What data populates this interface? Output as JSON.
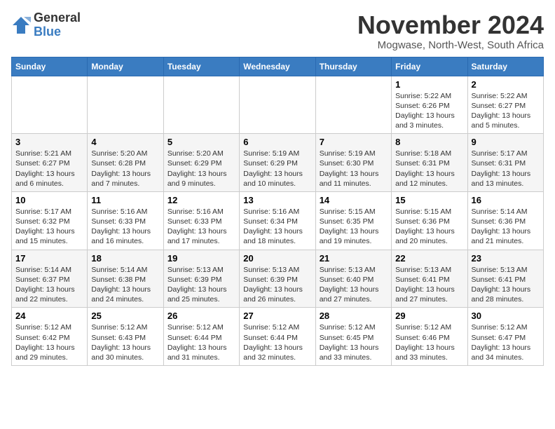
{
  "header": {
    "logo_general": "General",
    "logo_blue": "Blue",
    "month_title": "November 2024",
    "subtitle": "Mogwase, North-West, South Africa"
  },
  "days_of_week": [
    "Sunday",
    "Monday",
    "Tuesday",
    "Wednesday",
    "Thursday",
    "Friday",
    "Saturday"
  ],
  "weeks": [
    [
      {
        "day": "",
        "info": ""
      },
      {
        "day": "",
        "info": ""
      },
      {
        "day": "",
        "info": ""
      },
      {
        "day": "",
        "info": ""
      },
      {
        "day": "",
        "info": ""
      },
      {
        "day": "1",
        "info": "Sunrise: 5:22 AM\nSunset: 6:26 PM\nDaylight: 13 hours and 3 minutes."
      },
      {
        "day": "2",
        "info": "Sunrise: 5:22 AM\nSunset: 6:27 PM\nDaylight: 13 hours and 5 minutes."
      }
    ],
    [
      {
        "day": "3",
        "info": "Sunrise: 5:21 AM\nSunset: 6:27 PM\nDaylight: 13 hours and 6 minutes."
      },
      {
        "day": "4",
        "info": "Sunrise: 5:20 AM\nSunset: 6:28 PM\nDaylight: 13 hours and 7 minutes."
      },
      {
        "day": "5",
        "info": "Sunrise: 5:20 AM\nSunset: 6:29 PM\nDaylight: 13 hours and 9 minutes."
      },
      {
        "day": "6",
        "info": "Sunrise: 5:19 AM\nSunset: 6:29 PM\nDaylight: 13 hours and 10 minutes."
      },
      {
        "day": "7",
        "info": "Sunrise: 5:19 AM\nSunset: 6:30 PM\nDaylight: 13 hours and 11 minutes."
      },
      {
        "day": "8",
        "info": "Sunrise: 5:18 AM\nSunset: 6:31 PM\nDaylight: 13 hours and 12 minutes."
      },
      {
        "day": "9",
        "info": "Sunrise: 5:17 AM\nSunset: 6:31 PM\nDaylight: 13 hours and 13 minutes."
      }
    ],
    [
      {
        "day": "10",
        "info": "Sunrise: 5:17 AM\nSunset: 6:32 PM\nDaylight: 13 hours and 15 minutes."
      },
      {
        "day": "11",
        "info": "Sunrise: 5:16 AM\nSunset: 6:33 PM\nDaylight: 13 hours and 16 minutes."
      },
      {
        "day": "12",
        "info": "Sunrise: 5:16 AM\nSunset: 6:33 PM\nDaylight: 13 hours and 17 minutes."
      },
      {
        "day": "13",
        "info": "Sunrise: 5:16 AM\nSunset: 6:34 PM\nDaylight: 13 hours and 18 minutes."
      },
      {
        "day": "14",
        "info": "Sunrise: 5:15 AM\nSunset: 6:35 PM\nDaylight: 13 hours and 19 minutes."
      },
      {
        "day": "15",
        "info": "Sunrise: 5:15 AM\nSunset: 6:36 PM\nDaylight: 13 hours and 20 minutes."
      },
      {
        "day": "16",
        "info": "Sunrise: 5:14 AM\nSunset: 6:36 PM\nDaylight: 13 hours and 21 minutes."
      }
    ],
    [
      {
        "day": "17",
        "info": "Sunrise: 5:14 AM\nSunset: 6:37 PM\nDaylight: 13 hours and 22 minutes."
      },
      {
        "day": "18",
        "info": "Sunrise: 5:14 AM\nSunset: 6:38 PM\nDaylight: 13 hours and 24 minutes."
      },
      {
        "day": "19",
        "info": "Sunrise: 5:13 AM\nSunset: 6:39 PM\nDaylight: 13 hours and 25 minutes."
      },
      {
        "day": "20",
        "info": "Sunrise: 5:13 AM\nSunset: 6:39 PM\nDaylight: 13 hours and 26 minutes."
      },
      {
        "day": "21",
        "info": "Sunrise: 5:13 AM\nSunset: 6:40 PM\nDaylight: 13 hours and 27 minutes."
      },
      {
        "day": "22",
        "info": "Sunrise: 5:13 AM\nSunset: 6:41 PM\nDaylight: 13 hours and 27 minutes."
      },
      {
        "day": "23",
        "info": "Sunrise: 5:13 AM\nSunset: 6:41 PM\nDaylight: 13 hours and 28 minutes."
      }
    ],
    [
      {
        "day": "24",
        "info": "Sunrise: 5:12 AM\nSunset: 6:42 PM\nDaylight: 13 hours and 29 minutes."
      },
      {
        "day": "25",
        "info": "Sunrise: 5:12 AM\nSunset: 6:43 PM\nDaylight: 13 hours and 30 minutes."
      },
      {
        "day": "26",
        "info": "Sunrise: 5:12 AM\nSunset: 6:44 PM\nDaylight: 13 hours and 31 minutes."
      },
      {
        "day": "27",
        "info": "Sunrise: 5:12 AM\nSunset: 6:44 PM\nDaylight: 13 hours and 32 minutes."
      },
      {
        "day": "28",
        "info": "Sunrise: 5:12 AM\nSunset: 6:45 PM\nDaylight: 13 hours and 33 minutes."
      },
      {
        "day": "29",
        "info": "Sunrise: 5:12 AM\nSunset: 6:46 PM\nDaylight: 13 hours and 33 minutes."
      },
      {
        "day": "30",
        "info": "Sunrise: 5:12 AM\nSunset: 6:47 PM\nDaylight: 13 hours and 34 minutes."
      }
    ]
  ]
}
